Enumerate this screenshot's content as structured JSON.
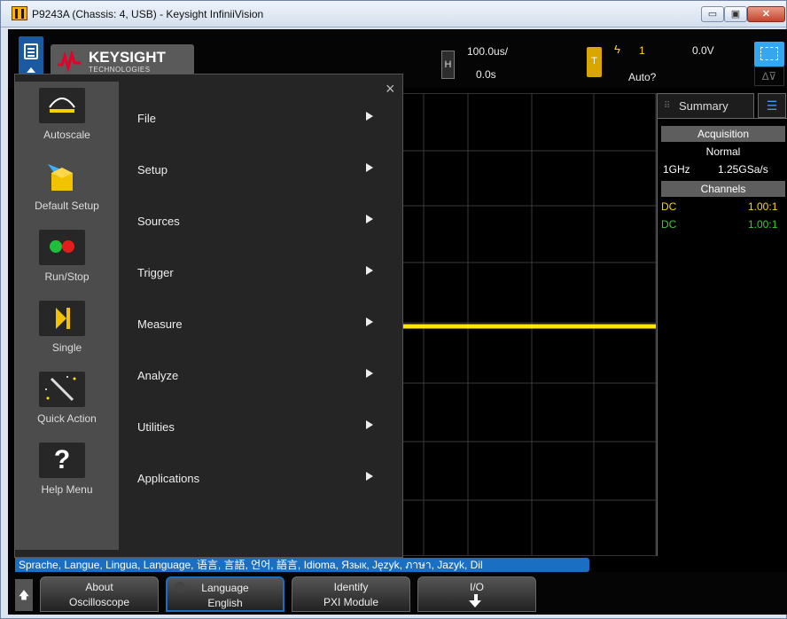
{
  "window": {
    "title": "P9243A (Chassis: 4, USB) - Keysight InfiniiVision",
    "minimize": "▭",
    "maximize": "▣",
    "close": "✕"
  },
  "brand": {
    "name": "KEYSIGHT",
    "subtitle": "TECHNOLOGIES",
    "color": "#e4002b"
  },
  "horizontal": {
    "label": "H",
    "timebase": "100.0us/",
    "position": "0.0s"
  },
  "trigger": {
    "label": "T",
    "slope_symbol": "ϟ",
    "source": "1",
    "level": "0.0V",
    "mode": "Auto?"
  },
  "delta_button": "∆⊽",
  "menu": {
    "close": "×",
    "quick_actions": [
      {
        "label": "Autoscale",
        "icon": "autoscale-icon"
      },
      {
        "label": "Default Setup",
        "icon": "default-setup-icon"
      },
      {
        "label": "Run/Stop",
        "icon": "run-stop-icon"
      },
      {
        "label": "Single",
        "icon": "single-icon"
      },
      {
        "label": "Quick Action",
        "icon": "quick-action-icon"
      },
      {
        "label": "Help Menu",
        "icon": "help-icon"
      }
    ],
    "items": [
      "File",
      "Setup",
      "Sources",
      "Trigger",
      "Measure",
      "Analyze",
      "Utilities",
      "Applications"
    ]
  },
  "sidepanel": {
    "tab": "Summary",
    "acquisition_header": "Acquisition",
    "acq_mode": "Normal",
    "bandwidth": "1GHz",
    "sample_rate": "1.25GSa/s",
    "channels_header": "Channels",
    "channels": [
      {
        "coupling": "DC",
        "probe": "1.00:1",
        "color": "#ffd700"
      },
      {
        "coupling": "DC",
        "probe": "1.00:1",
        "color": "#32d12a"
      }
    ]
  },
  "language_strip": "Sprache, Langue, Lingua, Language, 语言, 言語, 언어, 語言, Idioma, Язык, Język, ภาษา, Jazyk, Dil",
  "softkeys": {
    "up": "🡅",
    "about": [
      "About",
      "Oscilloscope"
    ],
    "language": [
      "Language",
      "English"
    ],
    "identify": [
      "Identify",
      "PXI Module"
    ],
    "io": [
      "I/O"
    ]
  },
  "colors": {
    "trace": "#ffe600",
    "accent": "#1a6fc2"
  }
}
